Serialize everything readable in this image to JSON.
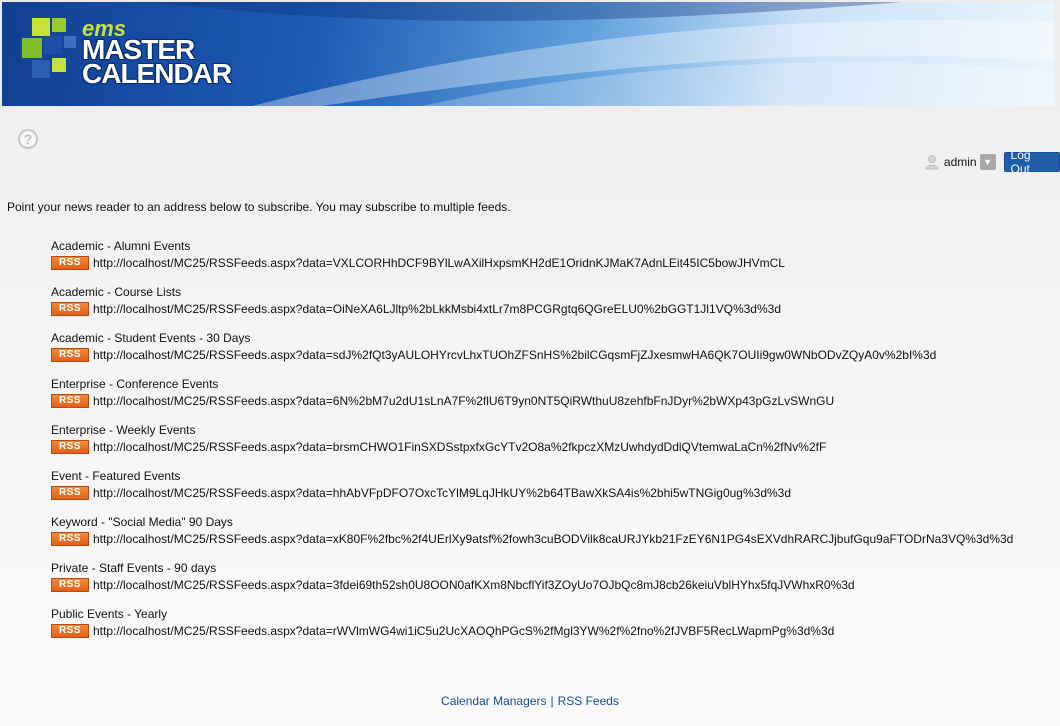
{
  "banner": {
    "logo_small": "ems",
    "logo_line1": "MASTER",
    "logo_line2": "CALENDAR"
  },
  "header": {
    "help_icon": "help-circle-icon",
    "username": "admin",
    "user_icon": "user-icon",
    "dropdown_icon": "chevron-down-icon",
    "logout_label": "Log Out"
  },
  "instructions": "Point your news reader to an address below to subscribe. You may subscribe to multiple feeds.",
  "rss_badge_label": "RSS",
  "feeds": [
    {
      "name": "Academic - Alumni Events",
      "url": "http://localhost/MC25/RSSFeeds.aspx?data=VXLCORHhDCF9BYlLwAXilHxpsmKH2dE1OridnKJMaK7AdnLEit45IC5bowJHVmCL"
    },
    {
      "name": "Academic - Course Lists",
      "url": "http://localhost/MC25/RSSFeeds.aspx?data=OiNeXA6LJltp%2bLkkMsbi4xtLr7m8PCGRgtq6QGreELU0%2bGGT1Jl1VQ%3d%3d"
    },
    {
      "name": "Academic - Student Events - 30 Days",
      "url": "http://localhost/MC25/RSSFeeds.aspx?data=sdJ%2fQt3yAULOHYrcvLhxTUOhZFSnHS%2bilCGqsmFjZJxesmwHA6QK7OUIi9gw0WNbODvZQyA0v%2bI%3d"
    },
    {
      "name": "Enterprise - Conference Events",
      "url": "http://localhost/MC25/RSSFeeds.aspx?data=6N%2bM7u2dU1sLnA7F%2flU6T9yn0NT5QiRWthuU8zehfbFnJDyr%2bWXp43pGzLvSWnGU"
    },
    {
      "name": "Enterprise - Weekly Events",
      "url": "http://localhost/MC25/RSSFeeds.aspx?data=brsmCHWO1FinSXDSstpxfxGcYTv2O8a%2fkpczXMzUwhdydDdlQVtemwaLaCn%2fNv%2fF"
    },
    {
      "name": "Event - Featured Events",
      "url": "http://localhost/MC25/RSSFeeds.aspx?data=hhAbVFpDFO7OxcTcYlM9LqJHkUY%2b64TBawXkSA4is%2bhi5wTNGig0ug%3d%3d"
    },
    {
      "name": "Keyword - \"Social Media\" 90 Days",
      "url": "http://localhost/MC25/RSSFeeds.aspx?data=xK80F%2fbc%2f4UErlXy9atsf%2fowh3cuBODVilk8caURJYkb21FzEY6N1PG4sEXVdhRARCJjbufGqu9aFTODrNa3VQ%3d%3d"
    },
    {
      "name": "Private - Staff Events - 90 days",
      "url": "http://localhost/MC25/RSSFeeds.aspx?data=3fdei69th52sh0U8OON0afKXm8NbcflYif3ZOyUo7OJbQc8mJ8cb26keiuVblHYhx5fqJVWhxR0%3d"
    },
    {
      "name": "Public Events - Yearly",
      "url": "http://localhost/MC25/RSSFeeds.aspx?data=rWVlmWG4wi1iC5u2UcXAOQhPGcS%2fMgl3YW%2f%2fno%2fJVBF5RecLWapmPg%3d%3d"
    }
  ],
  "footer": {
    "link1": "Calendar Managers",
    "separator": "|",
    "link2": "RSS Feeds"
  }
}
